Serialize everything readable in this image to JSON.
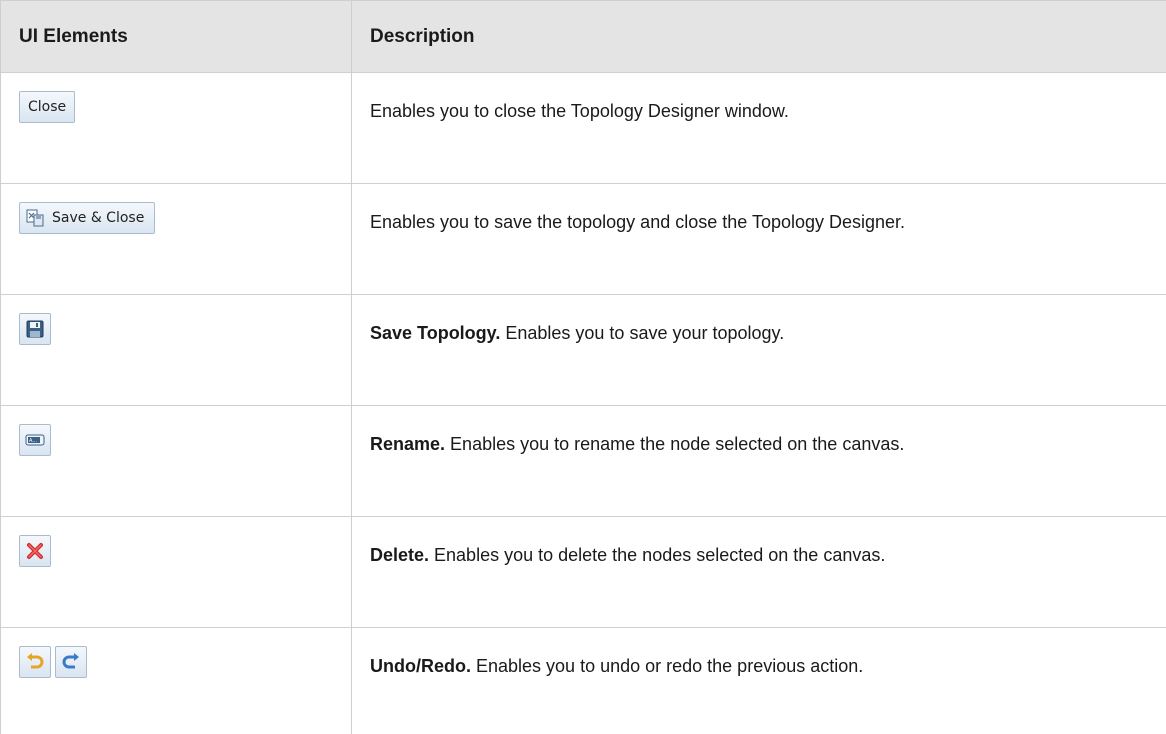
{
  "table": {
    "headers": {
      "elements": "UI Elements",
      "description": "Description"
    },
    "rows": [
      {
        "element_label": "Close",
        "bold": "",
        "text": "Enables you to close the Topology Designer window."
      },
      {
        "element_label": "Save & Close",
        "bold": "",
        "text": "Enables you to save the topology and close the Topology Designer."
      },
      {
        "element_icon": "floppy-disk-icon",
        "bold": "Save Topology.",
        "text": " Enables you to save your topology."
      },
      {
        "element_icon": "rename-icon",
        "bold": "Rename.",
        "text": " Enables you to rename the node selected on the canvas."
      },
      {
        "element_icon": "red-x-icon",
        "bold": "Delete.",
        "text": " Enables you to delete the nodes selected on the canvas."
      },
      {
        "element_icons": [
          "undo-icon",
          "redo-icon"
        ],
        "bold": "Undo/Redo.",
        "text": " Enables you to undo or redo the previous action."
      }
    ]
  }
}
